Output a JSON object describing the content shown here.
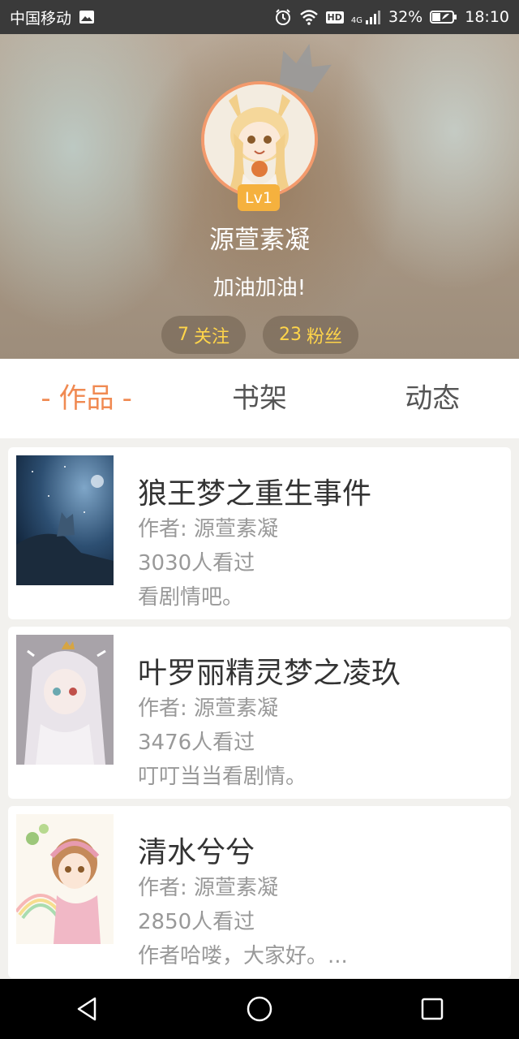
{
  "status_bar": {
    "carrier": "中国移动",
    "network": "4G",
    "hd": "HD",
    "battery": "32%",
    "time": "18:10"
  },
  "profile": {
    "level": "Lv1",
    "username": "源萱素凝",
    "signature": "加油加油!",
    "following_count": "7",
    "following_label": "关注",
    "fans_count": "23",
    "fans_label": "粉丝"
  },
  "tabs": [
    {
      "label": "作品",
      "active": true
    },
    {
      "label": "书架",
      "active": false
    },
    {
      "label": "动态",
      "active": false
    }
  ],
  "active_tab_marker": "-",
  "works": [
    {
      "title": "狼王梦之重生事件",
      "author": "作者: 源萱素凝",
      "views": "3030人看过",
      "description": "看剧情吧。",
      "cover_icon": "wolf-night-cover"
    },
    {
      "title": "叶罗丽精灵梦之凌玖",
      "author": "作者: 源萱素凝",
      "views": "3476人看过",
      "description": "叮叮当当看剧情。",
      "cover_icon": "anime-girl-cover"
    },
    {
      "title": "清水兮兮",
      "author": "作者: 源萱素凝",
      "views": "2850人看过",
      "description": "作者哈喽，大家好。...",
      "cover_icon": "anime-girl-rainbow-cover"
    }
  ],
  "colors": {
    "accent": "#f08a52",
    "level_badge": "#f5b13e",
    "stat_text": "#ffd54a"
  }
}
